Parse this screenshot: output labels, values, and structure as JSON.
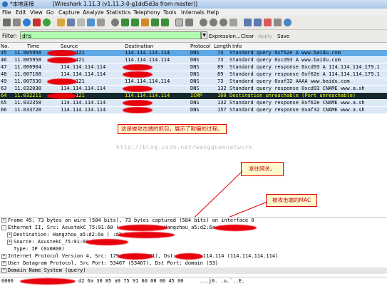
{
  "window": {
    "title": "*本地连接",
    "title_app": "[Wireshark 1.11.3 (v1.11.3-0-g1dd5d3a from master)]"
  },
  "menu": [
    "File",
    "Edit",
    "View",
    "Go",
    "Capture",
    "Analyze",
    "Statistics",
    "Telephony",
    "Tools",
    "Internals",
    "Help"
  ],
  "toolbar_icons": [
    "interface-list-icon",
    "options-icon",
    "start-capture-icon",
    "stop-capture-icon",
    "restart-capture-icon",
    "open-file-icon",
    "save-file-icon",
    "close-file-icon",
    "reload-icon",
    "print-icon",
    "find-icon",
    "back-icon",
    "forward-icon",
    "go-to-packet-icon",
    "first-packet-icon",
    "last-packet-icon",
    "colorize-icon",
    "auto-scroll-icon",
    "zoom-in-icon",
    "zoom-out-icon",
    "normal-size-icon",
    "resize-columns-icon",
    "capture-filters-icon",
    "display-filters-icon",
    "coloring-rules-icon",
    "preferences-icon",
    "help-icon"
  ],
  "filter": {
    "label": "Filter:",
    "value": "dns",
    "expression": "Expression...",
    "clear": "Clear",
    "apply": "Apply",
    "save": "Save"
  },
  "columns": {
    "no": "No.",
    "time": "Time",
    "source": "Source",
    "destination": "Destination",
    "protocol": "Protocol",
    "length": "Length",
    "info": "Info"
  },
  "packets": [
    {
      "no": "45",
      "time": "11.005958",
      "source": ".179.121",
      "destination": "114.114.114.114",
      "protocol": "DNS",
      "length": "73",
      "info": "Standard query 0xf62e  A www.baidu.com",
      "bg": "#5fa8e6",
      "fg": "#000000",
      "selected": true
    },
    {
      "no": "46",
      "time": "11.005958",
      "source": ".179.121",
      "destination": "114.114.114.114",
      "protocol": "DNS",
      "length": "73",
      "info": "Standard query 0xcd93  A www.baidu.com",
      "bg": "#dbe9f7",
      "fg": "#000000"
    },
    {
      "no": "47",
      "time": "11.006904",
      "source": "114.114.114.114",
      "destination": ".179.121",
      "protocol": "DNS",
      "length": "89",
      "info": "Standard query response 0xcd93  A 114.114.114.179.1",
      "bg": "#dbe9f7",
      "fg": "#000000"
    },
    {
      "no": "48",
      "time": "11.007168",
      "source": "114.114.114.114",
      "destination": ".179.121",
      "protocol": "DNS",
      "length": "89",
      "info": "Standard query response 0xf62e  A 114.114.114.179.1",
      "bg": "#dbe9f7",
      "fg": "#000000"
    },
    {
      "no": "49",
      "time": "11.007530",
      "source": ".179.121",
      "destination": "114.114.114.114",
      "protocol": "DNS",
      "length": "73",
      "info": "Standard query 0xaf32  AAAA www.baidu.com",
      "bg": "#dbe9f7",
      "fg": "#000000"
    },
    {
      "no": "63",
      "time": "11.032038",
      "source": "114.114.114.114",
      "destination": ".179.121",
      "protocol": "DNS",
      "length": "132",
      "info": "Standard query response 0xcd93  CNAME www.a.sh",
      "bg": "#dbe9f7",
      "fg": "#000000"
    },
    {
      "no": "64",
      "time": "11.032211",
      "source": ".179.121",
      "destination": "114.114.114.114",
      "protocol": "ICMP",
      "length": "160",
      "info": "Destination unreachable (Port unreachable)",
      "bg": "#12272e",
      "fg": "#ffff00"
    },
    {
      "no": "65",
      "time": "11.032358",
      "source": "114.114.114.114",
      "destination": ".179.121",
      "protocol": "DNS",
      "length": "132",
      "info": "Standard query response 0xf62e  CNAME www.a.sh",
      "bg": "#dbe9f7",
      "fg": "#000000"
    },
    {
      "no": "66",
      "time": "11.033728",
      "source": "114.114.114.114",
      "destination": ".179.121",
      "protocol": "DNS",
      "length": "157",
      "info": "Standard query response 0xaf32  CNAME www.a.sh",
      "bg": "#dbe9f7",
      "fg": "#000000"
    }
  ],
  "annotations": {
    "capture_note": "这是被攻击端的抓包，展示了欺骗的过程。",
    "gateway_note": "发往网关。",
    "victim_mac_note": "被攻击端的MAC"
  },
  "watermark": "http://blog.csdn.net/wangquannetwork",
  "details": [
    {
      "expander": "+",
      "text": "Frame 45: 73 bytes on wire (584 bits), 73 bytes captured (584 bits) on interface 0",
      "indent": 0
    },
    {
      "expander": "-",
      "text": "Ethernet II, Src: AsustekC_75:91:60 (            :91:60), Dst: Hangzhou_a5:d2:6a (            :d2:6a)",
      "indent": 0
    },
    {
      "expander": "+",
      "text": "Destination: Hangzhou_a5:d2:6a (            :d2:6a)",
      "indent": 1
    },
    {
      "expander": "+",
      "text": "Source: AsustekC_75:91:60 (            91:60)",
      "indent": 1
    },
    {
      "expander": "",
      "text": "Type: IP (0x0800)",
      "indent": 1
    },
    {
      "expander": "+",
      "text": "Internet Protocol Version 4, Src:           179.121 (          9.121), Dst: 114.114.114.114 (114.114.114.114)",
      "indent": 0
    },
    {
      "expander": "+",
      "text": "User Datagram Protocol, Src Port: 53467 (53467), Dst Port: domain (53)",
      "indent": 0
    },
    {
      "expander": "+",
      "text": "Domain Name System (query)",
      "indent": 0
    }
  ],
  "hex": {
    "offset": "0000",
    "bytes": "d2 6a 30 85  a9 75 91 60 08 00 45 00",
    "ascii": "...j0. .u.`..E."
  },
  "colors": {
    "redaction": "#e8000c",
    "annotation_border": "#e00000",
    "annotation_text": "#d00000",
    "filter_bg": "#afffaf"
  }
}
